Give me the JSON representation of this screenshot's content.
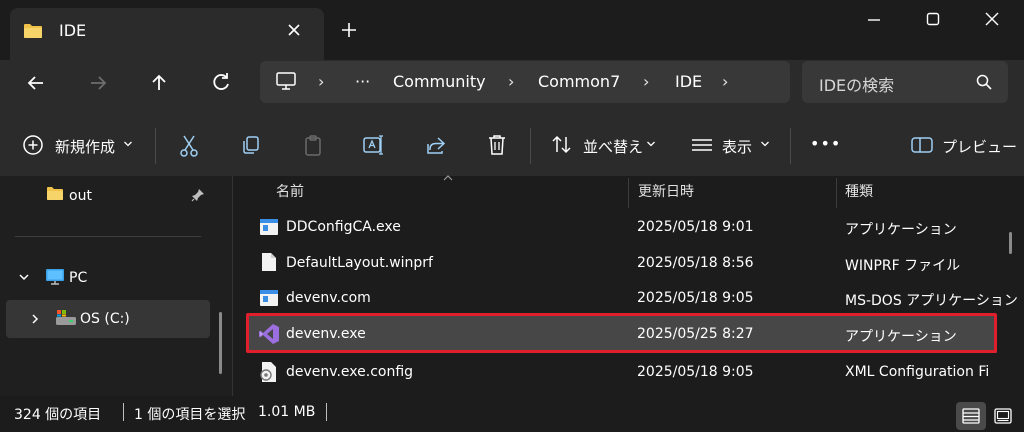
{
  "tab": {
    "title": "IDE"
  },
  "address": {
    "more": "···",
    "crumbs": [
      "Community",
      "Common7",
      "IDE"
    ],
    "separator": "›"
  },
  "search": {
    "placeholder": "IDEの検索"
  },
  "commands": {
    "new": "新規作成",
    "sort": "並べ替え",
    "view": "表示",
    "more": "•••",
    "preview": "プレビュー"
  },
  "nav": {
    "items": [
      {
        "label": "out"
      },
      {
        "label": "PC"
      },
      {
        "label": "OS (C:)"
      }
    ]
  },
  "columns": {
    "name": "名前",
    "date": "更新日時",
    "type": "種類"
  },
  "files": [
    {
      "name": "DDConfigCA.exe",
      "date": "2025/05/18 9:01",
      "type": "アプリケーション",
      "icon": "app-window-icon"
    },
    {
      "name": "DefaultLayout.winprf",
      "date": "2025/05/18 8:56",
      "type": "WINPRF ファイル",
      "icon": "document-icon"
    },
    {
      "name": "devenv.com",
      "date": "2025/05/18 9:05",
      "type": "MS-DOS アプリケーション",
      "icon": "app-window-icon"
    },
    {
      "name": "devenv.exe",
      "date": "2025/05/25 8:27",
      "type": "アプリケーション",
      "icon": "visual-studio-icon",
      "selected": true
    },
    {
      "name": "devenv.exe.config",
      "date": "2025/05/18 9:05",
      "type": "XML Configuration Fi",
      "icon": "config-file-icon"
    }
  ],
  "status": {
    "count": "324 個の項目",
    "selection": "1 個の項目を選択",
    "size": "1.01 MB"
  },
  "colors": {
    "accent_highlight": "#e01f2c",
    "folder": "#f0c24a",
    "visual_studio": "#9b6fe0"
  }
}
